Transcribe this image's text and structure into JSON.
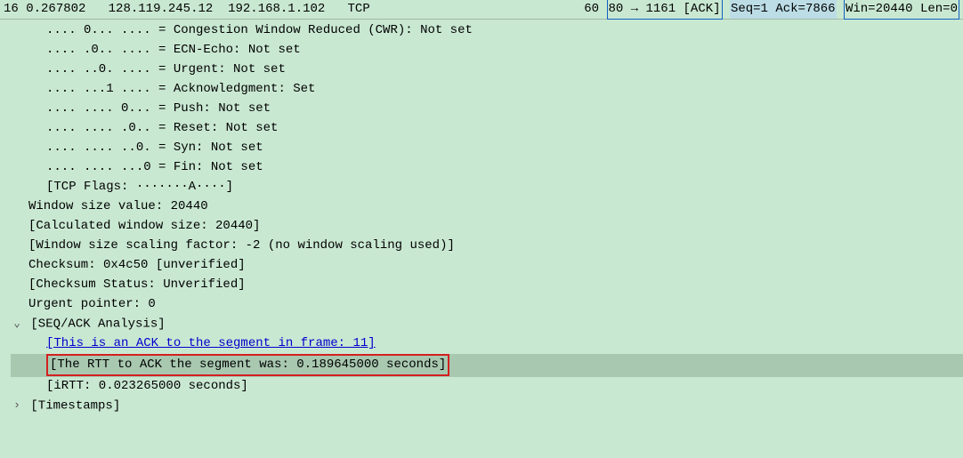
{
  "packet": {
    "no": "16",
    "time": "0.267802",
    "src": "128.119.245.12",
    "dst": "192.168.1.102",
    "proto": "TCP",
    "len": "60",
    "info_port": "80 → 1161 [ACK]",
    "info_seq": "Seq=1 Ack=7866",
    "info_win": "Win=20440 Len=0"
  },
  "flags": {
    "cwr": ".... 0... .... = Congestion Window Reduced (CWR): Not set",
    "ecn": ".... .0.. .... = ECN-Echo: Not set",
    "urg": ".... ..0. .... = Urgent: Not set",
    "ack": ".... ...1 .... = Acknowledgment: Set",
    "psh": ".... .... 0... = Push: Not set",
    "rst": ".... .... .0.. = Reset: Not set",
    "syn": ".... .... ..0. = Syn: Not set",
    "fin": ".... .... ...0 = Fin: Not set",
    "summary": "[TCP Flags: ·······A····]"
  },
  "tcp": {
    "winsize": "Window size value: 20440",
    "calcwin": "[Calculated window size: 20440]",
    "scaling": "[Window size scaling factor: -2 (no window scaling used)]",
    "checksum": "Checksum: 0x4c50 [unverified]",
    "chkstatus": "[Checksum Status: Unverified]",
    "urgent": "Urgent pointer: 0"
  },
  "seqack": {
    "header": "[SEQ/ACK Analysis]",
    "ack_to": "[This is an ACK to the segment in frame: 11]",
    "rtt": "[The RTT to ACK the segment was: 0.189645000 seconds]",
    "irtt": "[iRTT: 0.023265000 seconds]"
  },
  "timestamps": {
    "header": "[Timestamps]"
  }
}
